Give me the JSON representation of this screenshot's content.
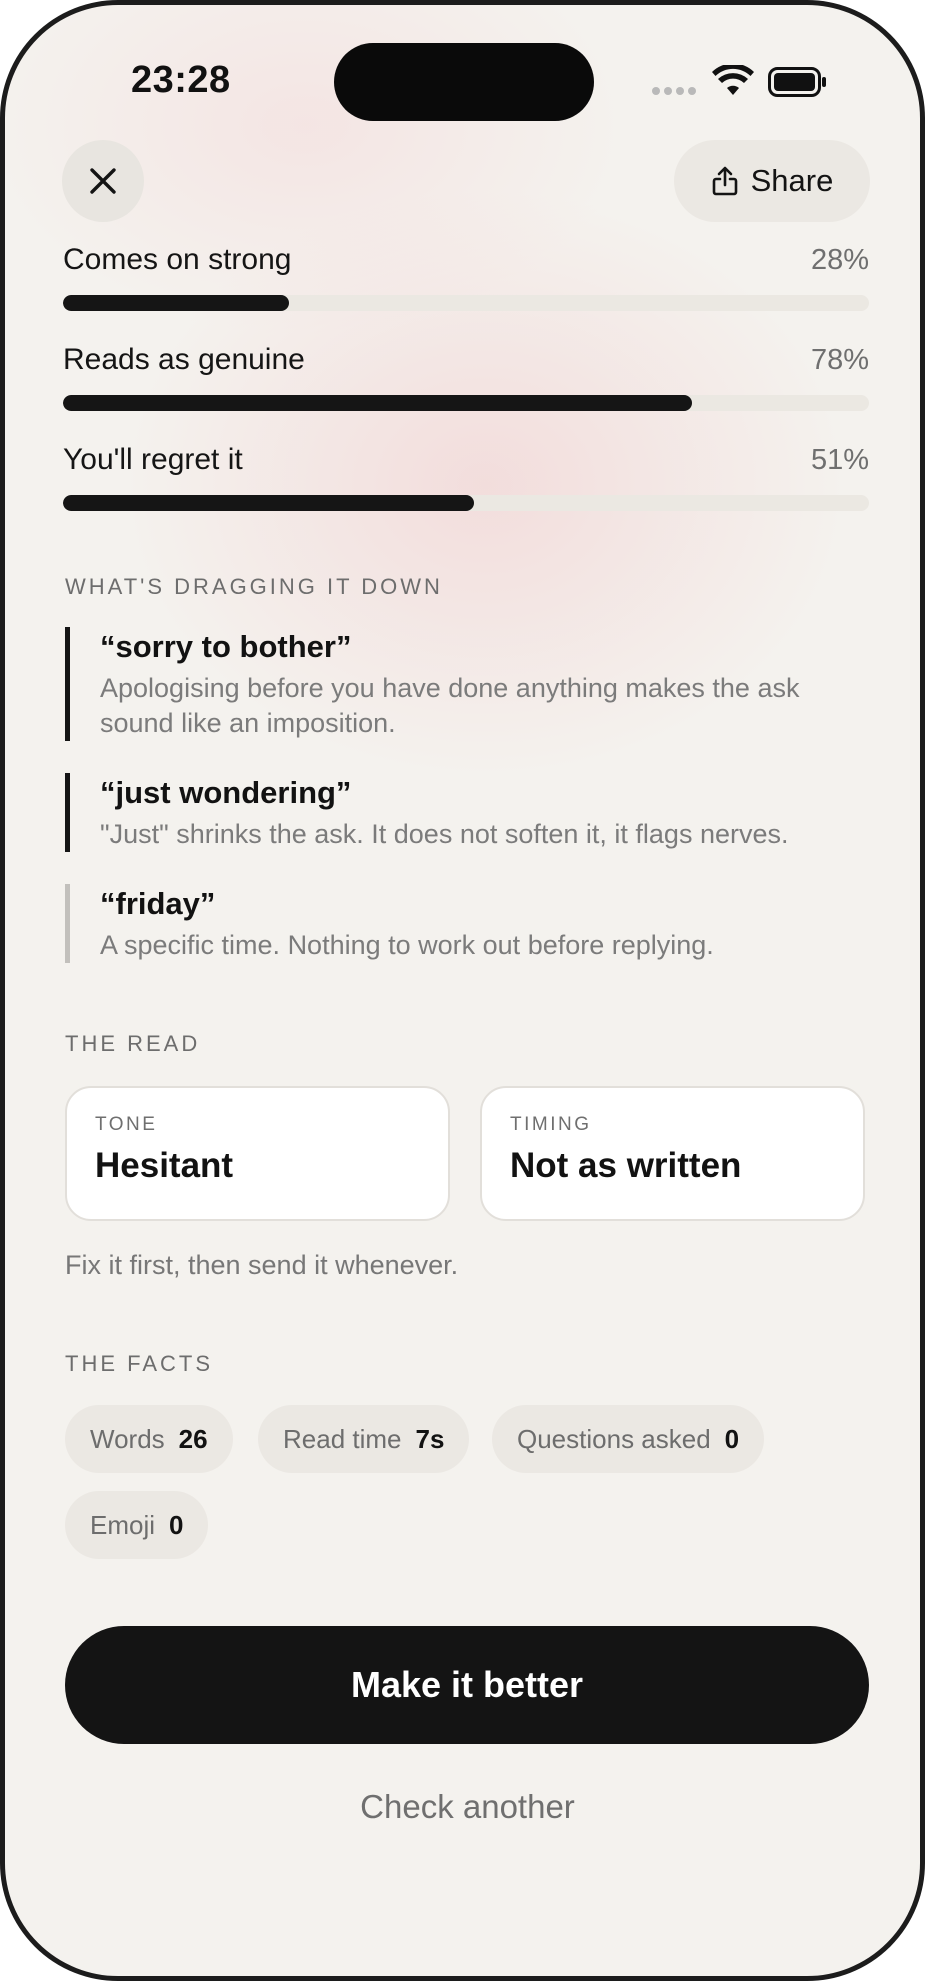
{
  "status_bar": {
    "time": "23:28"
  },
  "header": {
    "share_label": "Share"
  },
  "metrics": [
    {
      "label": "Comes on strong",
      "percent_text": "28%",
      "value": 0.28
    },
    {
      "label": "Reads as genuine",
      "percent_text": "78%",
      "value": 0.78
    },
    {
      "label": "You'll regret it",
      "percent_text": "51%",
      "value": 0.51
    }
  ],
  "dragging": {
    "title": "WHAT'S DRAGGING IT DOWN",
    "items": [
      {
        "quote": "“sorry to bother”",
        "detail": "Apologising before you have done anything makes the ask sound like an imposition."
      },
      {
        "quote": "“just wondering”",
        "detail": "\"Just\" shrinks the ask. It does not soften it, it flags nerves."
      },
      {
        "quote": "“friday”",
        "detail": "A specific time. Nothing to work out before replying."
      }
    ]
  },
  "read": {
    "title": "THE READ",
    "tone_key": "TONE",
    "tone_value": "Hesitant",
    "timing_key": "TIMING",
    "timing_value": "Not as written",
    "advice": "Fix it first, then send it whenever."
  },
  "facts": {
    "title": "THE FACTS",
    "items": [
      {
        "key": "Words",
        "value": "26"
      },
      {
        "key": "Read time",
        "value": "7s"
      },
      {
        "key": "Questions asked",
        "value": "0"
      },
      {
        "key": "Emoji",
        "value": "0"
      }
    ]
  },
  "actions": {
    "primary": "Make it better",
    "secondary": "Check another"
  },
  "colors": {
    "accent": "#141414",
    "background": "#f4f2ee",
    "muted_bar": "#c2c0bc"
  }
}
